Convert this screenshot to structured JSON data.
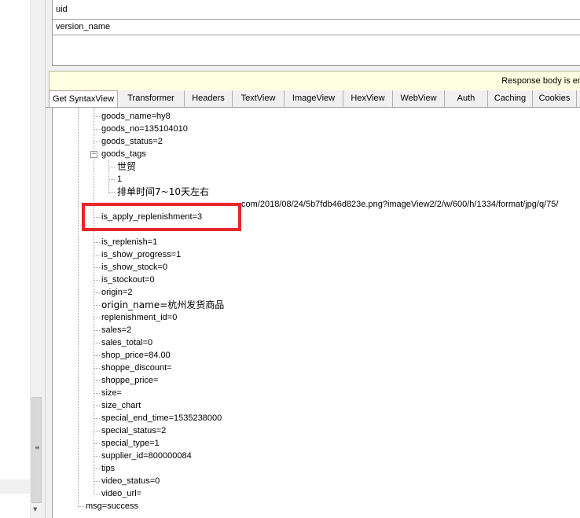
{
  "request_headers": {
    "rows": [
      "uid",
      "version_name"
    ]
  },
  "response_bar": {
    "text": "Response body is en"
  },
  "tabs": [
    {
      "label": "Get SyntaxView"
    },
    {
      "label": "Transformer"
    },
    {
      "label": "Headers"
    },
    {
      "label": "TextView"
    },
    {
      "label": "ImageView"
    },
    {
      "label": "HexView"
    },
    {
      "label": "WebView"
    },
    {
      "label": "Auth"
    },
    {
      "label": "Caching"
    },
    {
      "label": "Cookies"
    }
  ],
  "tree": {
    "goods_name": "goods_name=hy8",
    "goods_no": "goods_no=135104010",
    "goods_status": "goods_status=2",
    "goods_tags": "goods_tags",
    "tag_items": [
      "世贸",
      "1",
      "排单时间7~10天左右"
    ],
    "image_url_tail": "com/2018/08/24/5b7fdb46d823e.png?imageView2/2/w/600/h/1334/format/jpg/q/75/",
    "is_apply_replenishment": "is_apply_replenishment=3",
    "fields": [
      "is_replenish=1",
      "is_show_progress=1",
      "is_show_stock=0",
      "is_stockout=0",
      "origin=2",
      "origin_name=杭州发货商品",
      "replenishment_id=0",
      "sales=2",
      "sales_total=0",
      "shop_price=84.00",
      "shoppe_discount=",
      "shoppe_price=",
      "size=",
      "size_chart",
      "special_end_time=1535238000",
      "special_status=2",
      "special_type=1",
      "supplier_id=800000084",
      "tips",
      "video_status=0",
      "video_url="
    ],
    "msg": "msg=success"
  },
  "colors": {
    "highlight_box": "#e8262b",
    "info_bar": "#ffffe1"
  }
}
